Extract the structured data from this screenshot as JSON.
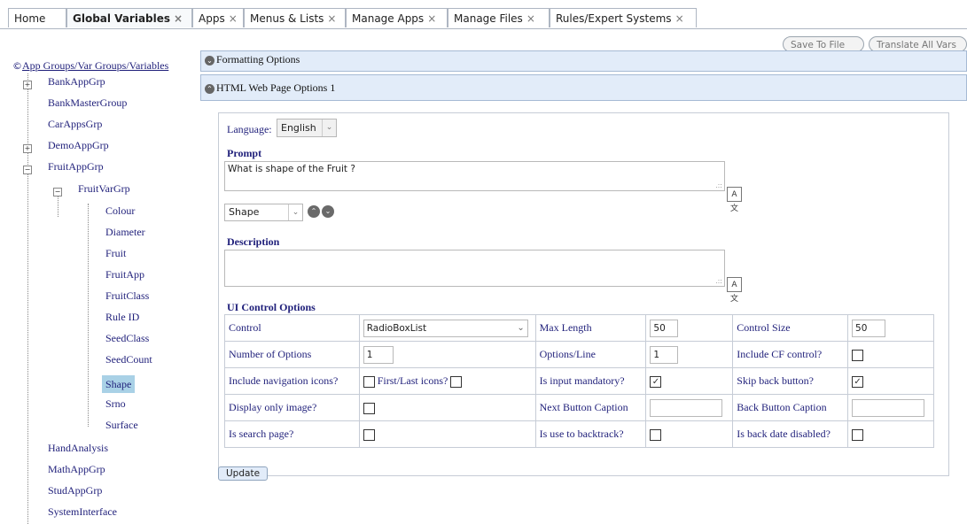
{
  "tabs": [
    {
      "label": "Home",
      "closable": false,
      "active": false
    },
    {
      "label": "Global Variables",
      "closable": true,
      "active": true
    },
    {
      "label": "Apps",
      "closable": true,
      "active": false
    },
    {
      "label": "Menus & Lists",
      "closable": true,
      "active": false
    },
    {
      "label": "Manage Apps",
      "closable": true,
      "active": false
    },
    {
      "label": "Manage Files",
      "closable": true,
      "active": false
    },
    {
      "label": "Rules/Expert Systems",
      "closable": true,
      "active": false
    }
  ],
  "close_glyph": "×",
  "toolbar": {
    "save_to_file": "Save To File",
    "translate_all": "Translate All Vars"
  },
  "tree": {
    "root": "App Groups/Var Groups/Variables",
    "groups": [
      {
        "label": "BankAppGrp"
      },
      {
        "label": "BankMasterGroup"
      },
      {
        "label": "CarAppsGrp"
      },
      {
        "label": "DemoAppGrp"
      },
      {
        "label": "FruitAppGrp"
      },
      {
        "label": "FruitVarGrp"
      },
      {
        "label": "HandAnalysis"
      },
      {
        "label": "MathAppGrp"
      },
      {
        "label": "StudAppGrp"
      },
      {
        "label": "SystemInterface"
      }
    ],
    "variables": [
      "Colour",
      "Diameter",
      "Fruit",
      "FruitApp",
      "FruitClass",
      "Rule ID",
      "SeedClass",
      "SeedCount",
      "Shape",
      "Srno",
      "Surface"
    ],
    "selected": "Shape"
  },
  "sections": {
    "formatting": "Formatting Options",
    "html": "HTML Web Page Options 1"
  },
  "form": {
    "language_label": "Language:",
    "language_value": "English",
    "prompt_label": "Prompt",
    "prompt_value": "What is shape of the Fruit ?",
    "variable_select": "Shape",
    "description_label": "Description",
    "description_value": "",
    "ui_options_label": "UI Control Options",
    "update_button": "Update"
  },
  "ui": {
    "control_label": "Control",
    "control_value": "RadioBoxList",
    "max_length_label": "Max Length",
    "max_length_value": "50",
    "control_size_label": "Control Size",
    "control_size_value": "50",
    "num_options_label": "Number of Options",
    "num_options_value": "1",
    "options_line_label": "Options/Line",
    "options_line_value": "1",
    "include_cf_label": "Include CF control?",
    "nav_icons_label": "Include navigation icons?",
    "first_last_label": "First/Last icons?",
    "mandatory_label": "Is input mandatory?",
    "skip_back_label": "Skip back button?",
    "display_image_label": "Display only image?",
    "next_caption_label": "Next Button Caption",
    "next_caption_value": "",
    "back_caption_label": "Back Button Caption",
    "back_caption_value": "",
    "search_page_label": "Is search page?",
    "backtrack_label": "Is use to backtrack?",
    "back_date_label": "Is back date disabled?"
  },
  "checkboxes": {
    "include_cf": false,
    "nav_icons": false,
    "first_last": false,
    "mandatory": true,
    "skip_back": true,
    "display_image": false,
    "search_page": false,
    "backtrack": false,
    "back_date": false
  },
  "icons": {
    "copyright": "copyright-icon",
    "expand": "plus-icon",
    "collapse": "minus-icon",
    "section_toggle": "chevron-circle-icon",
    "translate": "translate-icon",
    "dropdown": "chevron-down-icon"
  }
}
